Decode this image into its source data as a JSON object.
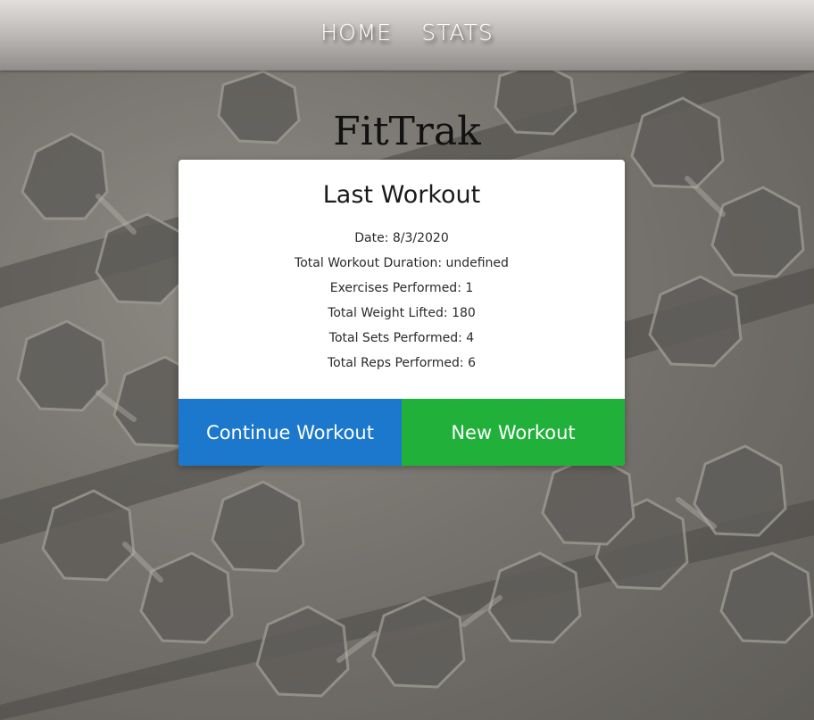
{
  "nav": {
    "items": [
      {
        "label": "HOME"
      },
      {
        "label": "STATS"
      }
    ]
  },
  "brand": {
    "title": "FitTrak"
  },
  "card": {
    "title": "Last Workout",
    "stats": [
      {
        "text": "Date: 8/3/2020"
      },
      {
        "text": "Total Workout Duration: undefined"
      },
      {
        "text": "Exercises Performed: 1"
      },
      {
        "text": "Total Weight Lifted: 180"
      },
      {
        "text": "Total Sets Performed: 4"
      },
      {
        "text": "Total Reps Performed: 6"
      }
    ],
    "actions": {
      "continue_label": "Continue Workout",
      "new_label": "New Workout"
    }
  },
  "colors": {
    "continue_button": "#1b78cd",
    "new_button": "#21b13b",
    "card_background": "#ffffff"
  }
}
